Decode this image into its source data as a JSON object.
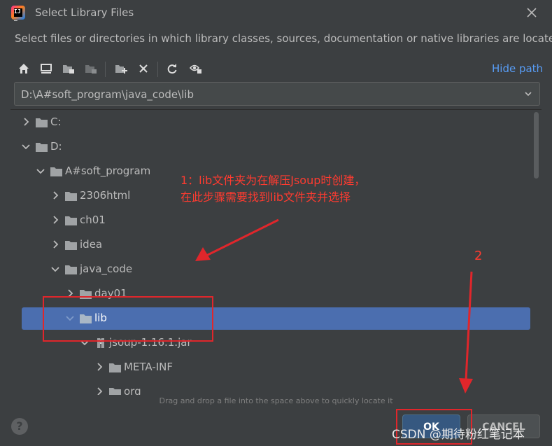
{
  "window": {
    "title": "Select Library Files",
    "description": "Select files or directories in which library classes, sources, documentation or native libraries are located"
  },
  "toolbar": {
    "buttons": [
      "home-icon",
      "desktop-icon",
      "project-folder-icon",
      "module-folder-icon",
      "new-folder-icon",
      "delete-icon",
      "refresh-icon",
      "show-hidden-icon"
    ],
    "hide_path_label": "Hide path"
  },
  "path": {
    "value": "D:\\A#soft_program\\java_code\\lib"
  },
  "tree": {
    "rows": [
      {
        "label": "C:",
        "expanded": false,
        "type": "folder"
      },
      {
        "label": "D:",
        "expanded": true,
        "type": "folder"
      },
      {
        "label": "A#soft_program",
        "expanded": true,
        "type": "folder"
      },
      {
        "label": "2306html",
        "expanded": false,
        "type": "folder"
      },
      {
        "label": "ch01",
        "expanded": false,
        "type": "folder"
      },
      {
        "label": "idea",
        "expanded": false,
        "type": "folder"
      },
      {
        "label": "java_code",
        "expanded": true,
        "type": "folder"
      },
      {
        "label": "day01",
        "expanded": false,
        "type": "folder"
      },
      {
        "label": "lib",
        "expanded": true,
        "type": "folder",
        "selected": true
      },
      {
        "label": "jsoup-1.16.1.jar",
        "expanded": true,
        "type": "jar"
      },
      {
        "label": "META-INF",
        "expanded": false,
        "type": "folder"
      },
      {
        "label": "org",
        "expanded": false,
        "type": "folder"
      }
    ]
  },
  "hint": "Drag and drop a file into the space above to quickly locate it",
  "buttons": {
    "ok": "OK",
    "cancel": "CANCEL",
    "help": "?"
  },
  "annotations": {
    "note1_line1": "1：lib文件夹为在解压Jsoup时创建，",
    "note1_line2": "在此步骤需要找到lib文件夹并选择",
    "note2": "2"
  },
  "watermark": "CSDN @期待粉红笔记本",
  "colors": {
    "background": "#3c3f41",
    "selection": "#4b6eaf",
    "link": "#589df6",
    "annotation": "#e0262b"
  }
}
